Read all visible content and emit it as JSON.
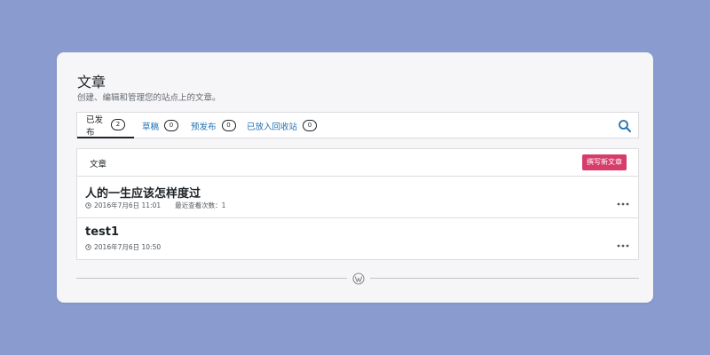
{
  "header": {
    "title": "文章",
    "subtitle": "创建、编辑和管理您的站点上的文章。"
  },
  "tabs": [
    {
      "label": "已发布",
      "count": "2",
      "active": true
    },
    {
      "label": "草稿",
      "count": "0",
      "active": false
    },
    {
      "label": "预发布",
      "count": "0",
      "active": false
    },
    {
      "label": "已放入回收站",
      "count": "0",
      "active": false
    }
  ],
  "list": {
    "header_label": "文章",
    "new_post_label": "撰写新文章",
    "posts": [
      {
        "title": "人的一生应该怎样度过",
        "date": "2016年7月6日 11:01",
        "views": "最近查看次数：1"
      },
      {
        "title": "test1",
        "date": "2016年7月6日 10:50",
        "views": ""
      }
    ]
  },
  "icons": {
    "search": "search-icon",
    "clock": "clock-icon",
    "more": "ellipsis-icon",
    "logo": "wordpress-logo-icon"
  },
  "colors": {
    "background": "#8a9ccf",
    "accent": "#2271b1",
    "primary_button": "#d63d6a"
  }
}
